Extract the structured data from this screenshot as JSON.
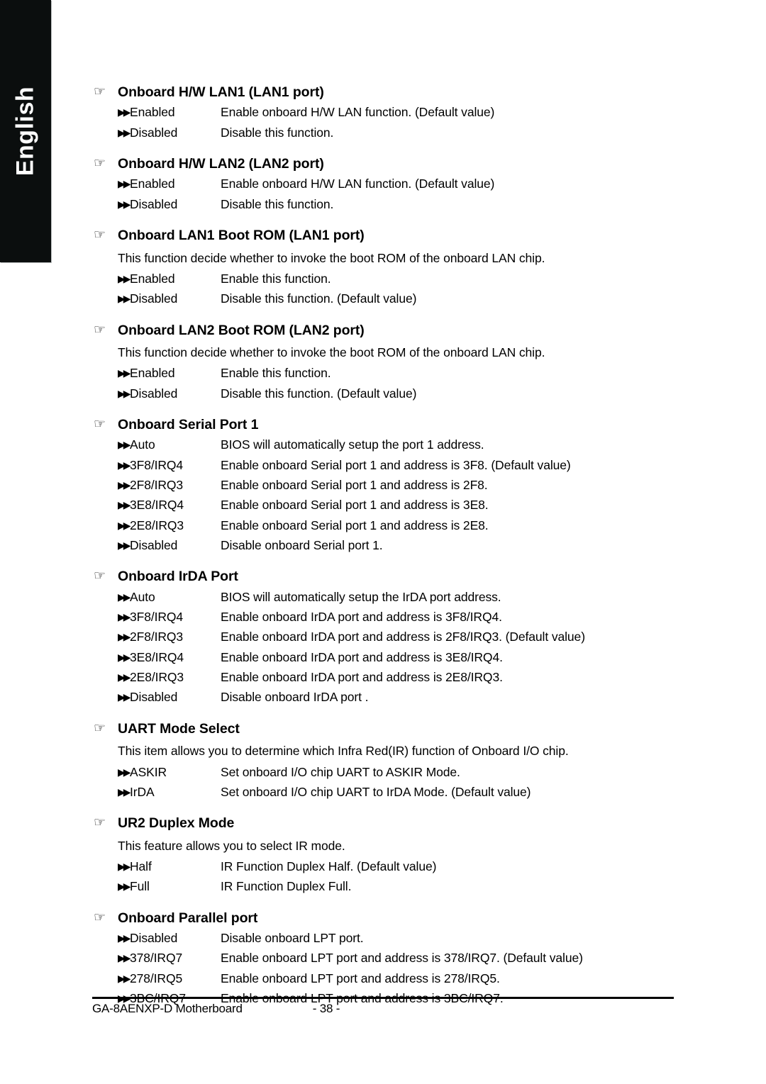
{
  "sidebar": {
    "language_label": "English"
  },
  "icons": {
    "hand": "☞",
    "bullet": "▶▶"
  },
  "sections": [
    {
      "title": "Onboard H/W LAN1 (LAN1 port)",
      "description": "",
      "options": [
        {
          "name": "Enabled",
          "desc": "Enable onboard H/W LAN function. (Default value)"
        },
        {
          "name": "Disabled",
          "desc": "Disable this function."
        }
      ]
    },
    {
      "title": "Onboard H/W LAN2 (LAN2 port)",
      "description": "",
      "options": [
        {
          "name": "Enabled",
          "desc": "Enable onboard H/W LAN function. (Default value)"
        },
        {
          "name": "Disabled",
          "desc": "Disable this function."
        }
      ]
    },
    {
      "title": "Onboard LAN1 Boot ROM (LAN1 port)",
      "description": "This function decide whether to invoke the boot ROM of the onboard LAN chip.",
      "options": [
        {
          "name": "Enabled",
          "desc": "Enable this function."
        },
        {
          "name": "Disabled",
          "desc": "Disable this function. (Default value)"
        }
      ]
    },
    {
      "title": "Onboard LAN2 Boot ROM (LAN2 port)",
      "description": "This function decide whether to invoke the boot ROM of the onboard LAN chip.",
      "options": [
        {
          "name": "Enabled",
          "desc": "Enable this function."
        },
        {
          "name": "Disabled",
          "desc": "Disable this function. (Default value)"
        }
      ]
    },
    {
      "title": "Onboard Serial Port 1",
      "description": "",
      "options": [
        {
          "name": "Auto",
          "desc": "BIOS will automatically setup the port 1 address."
        },
        {
          "name": "3F8/IRQ4",
          "desc": "Enable onboard Serial port 1 and address is 3F8. (Default value)"
        },
        {
          "name": "2F8/IRQ3",
          "desc": "Enable onboard Serial port 1 and address is 2F8."
        },
        {
          "name": "3E8/IRQ4",
          "desc": "Enable onboard Serial port 1 and address is 3E8."
        },
        {
          "name": "2E8/IRQ3",
          "desc": "Enable onboard Serial port 1 and address is 2E8."
        },
        {
          "name": "Disabled",
          "desc": "Disable onboard Serial port 1."
        }
      ]
    },
    {
      "title": "Onboard IrDA Port",
      "description": "",
      "options": [
        {
          "name": "Auto",
          "desc": "BIOS will automatically setup the IrDA port address."
        },
        {
          "name": "3F8/IRQ4",
          "desc": "Enable onboard IrDA port and address is 3F8/IRQ4."
        },
        {
          "name": "2F8/IRQ3",
          "desc": "Enable onboard IrDA port and address is 2F8/IRQ3. (Default value)"
        },
        {
          "name": "3E8/IRQ4",
          "desc": "Enable onboard IrDA port and address is 3E8/IRQ4."
        },
        {
          "name": "2E8/IRQ3",
          "desc": "Enable onboard IrDA port and address is 2E8/IRQ3."
        },
        {
          "name": "Disabled",
          "desc": "Disable onboard IrDA port ."
        }
      ]
    },
    {
      "title": "UART Mode Select",
      "description": "This item allows you to determine which Infra Red(IR) function of Onboard I/O chip.",
      "options": [
        {
          "name": "ASKIR",
          "desc": "Set onboard I/O chip UART to ASKIR Mode."
        },
        {
          "name": "IrDA",
          "desc": "Set onboard I/O chip UART to IrDA Mode. (Default value)"
        }
      ]
    },
    {
      "title": "UR2 Duplex Mode",
      "description": "This feature allows you to select IR mode.",
      "options": [
        {
          "name": "Half",
          "desc": "IR Function Duplex Half. (Default value)"
        },
        {
          "name": "Full",
          "desc": "IR Function Duplex Full."
        }
      ]
    },
    {
      "title": "Onboard Parallel port",
      "description": "",
      "options": [
        {
          "name": "Disabled",
          "desc": "Disable onboard LPT port."
        },
        {
          "name": "378/IRQ7",
          "desc": "Enable onboard LPT port and address is 378/IRQ7. (Default value)"
        },
        {
          "name": "278/IRQ5",
          "desc": "Enable onboard LPT port and address is 278/IRQ5."
        },
        {
          "name": "3BC/IRQ7",
          "desc": "Enable onboard LPT port and address is 3BC/IRQ7."
        }
      ]
    }
  ],
  "footer": {
    "doc_title": "GA-8AENXP-D Motherboard",
    "page_number": "- 38 -"
  }
}
